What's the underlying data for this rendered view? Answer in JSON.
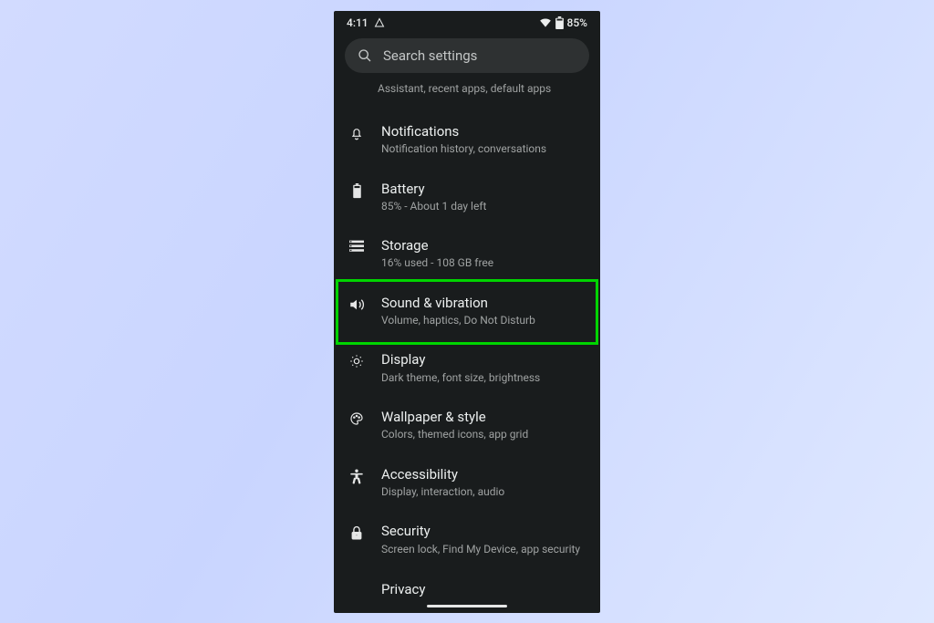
{
  "status": {
    "time": "4:11",
    "battery_text": "85%"
  },
  "search": {
    "placeholder": "Search settings"
  },
  "partial_item_sub": "Assistant, recent apps, default apps",
  "items": [
    {
      "title": "Notifications",
      "sub": "Notification history, conversations"
    },
    {
      "title": "Battery",
      "sub": "85% - About 1 day left"
    },
    {
      "title": "Storage",
      "sub": "16% used - 108 GB free"
    },
    {
      "title": "Sound & vibration",
      "sub": "Volume, haptics, Do Not Disturb"
    },
    {
      "title": "Display",
      "sub": "Dark theme, font size, brightness"
    },
    {
      "title": "Wallpaper & style",
      "sub": "Colors, themed icons, app grid"
    },
    {
      "title": "Accessibility",
      "sub": "Display, interaction, audio"
    },
    {
      "title": "Security",
      "sub": "Screen lock, Find My Device, app security"
    }
  ],
  "peek_item": "Privacy",
  "highlight_index": 3,
  "colors": {
    "highlight": "#00d400",
    "bg": "#191c1d",
    "pill": "#2e3132",
    "text": "#ecefef",
    "subtext": "#9fa2a2"
  }
}
